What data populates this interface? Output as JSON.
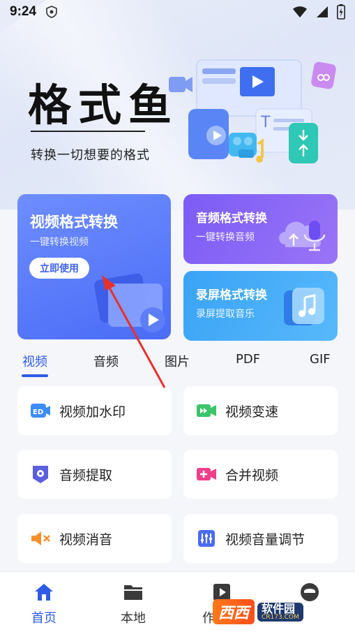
{
  "status_bar": {
    "time": "9:24",
    "icons": [
      "shield-icon",
      "wifi-icon",
      "signal-icon",
      "battery-icon"
    ]
  },
  "header": {
    "app_title": "格式鱼",
    "subtitle": "转换一切想要的格式"
  },
  "cards": {
    "video": {
      "title": "视频格式转换",
      "desc": "一键转换视频",
      "button": "立即使用"
    },
    "audio": {
      "title": "音频格式转换",
      "desc": "一键转换音频"
    },
    "screen": {
      "title": "录屏格式转换",
      "desc": "录屏提取音乐"
    }
  },
  "tabs": [
    {
      "label": "视频",
      "active": true
    },
    {
      "label": "音频",
      "active": false
    },
    {
      "label": "图片",
      "active": false
    },
    {
      "label": "PDF",
      "active": false
    },
    {
      "label": "GIF",
      "active": false
    }
  ],
  "tools": [
    {
      "label": "视频加水印",
      "icon": "watermark-icon",
      "color": "#3d8df5"
    },
    {
      "label": "视频变速",
      "icon": "speed-icon",
      "color": "#3cc46a"
    },
    {
      "label": "音频提取",
      "icon": "audio-extract-icon",
      "color": "#5a5fe0"
    },
    {
      "label": "合并视频",
      "icon": "merge-icon",
      "color": "#ee3f8a"
    },
    {
      "label": "视频消音",
      "icon": "mute-icon",
      "color": "#f7902b"
    },
    {
      "label": "视频音量调节",
      "icon": "volume-adjust-icon",
      "color": "#4a6cf0"
    }
  ],
  "bottom_nav": [
    {
      "label": "首页",
      "icon": "home-icon",
      "active": true
    },
    {
      "label": "本地",
      "icon": "folder-icon",
      "active": false
    },
    {
      "label": "作品",
      "icon": "works-icon",
      "active": false
    },
    {
      "label": "",
      "icon": "profile-icon",
      "active": false
    }
  ],
  "watermark": {
    "left": "西西",
    "right_top": "软件园",
    "right_bottom": "CR173.COM"
  },
  "colors": {
    "accent": "#2e5be6",
    "video_card": "#5577f7",
    "audio_card": "#8766f6",
    "screen_card": "#46aef8"
  }
}
